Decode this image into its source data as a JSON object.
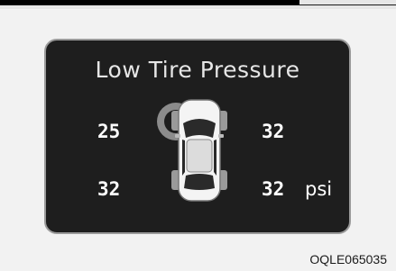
{
  "display": {
    "title": "Low Tire Pressure",
    "unit": "psi",
    "tires": {
      "front_left": "25",
      "front_right": "32",
      "rear_left": "32",
      "rear_right": "32"
    },
    "low_tire": "front_left",
    "colors": {
      "panel_bg": "#1e1e1e",
      "border": "#9a9a9a",
      "text": "#ffffff",
      "warning_ring": "#8c8c8c"
    }
  },
  "figure_code": "OQLE065035"
}
